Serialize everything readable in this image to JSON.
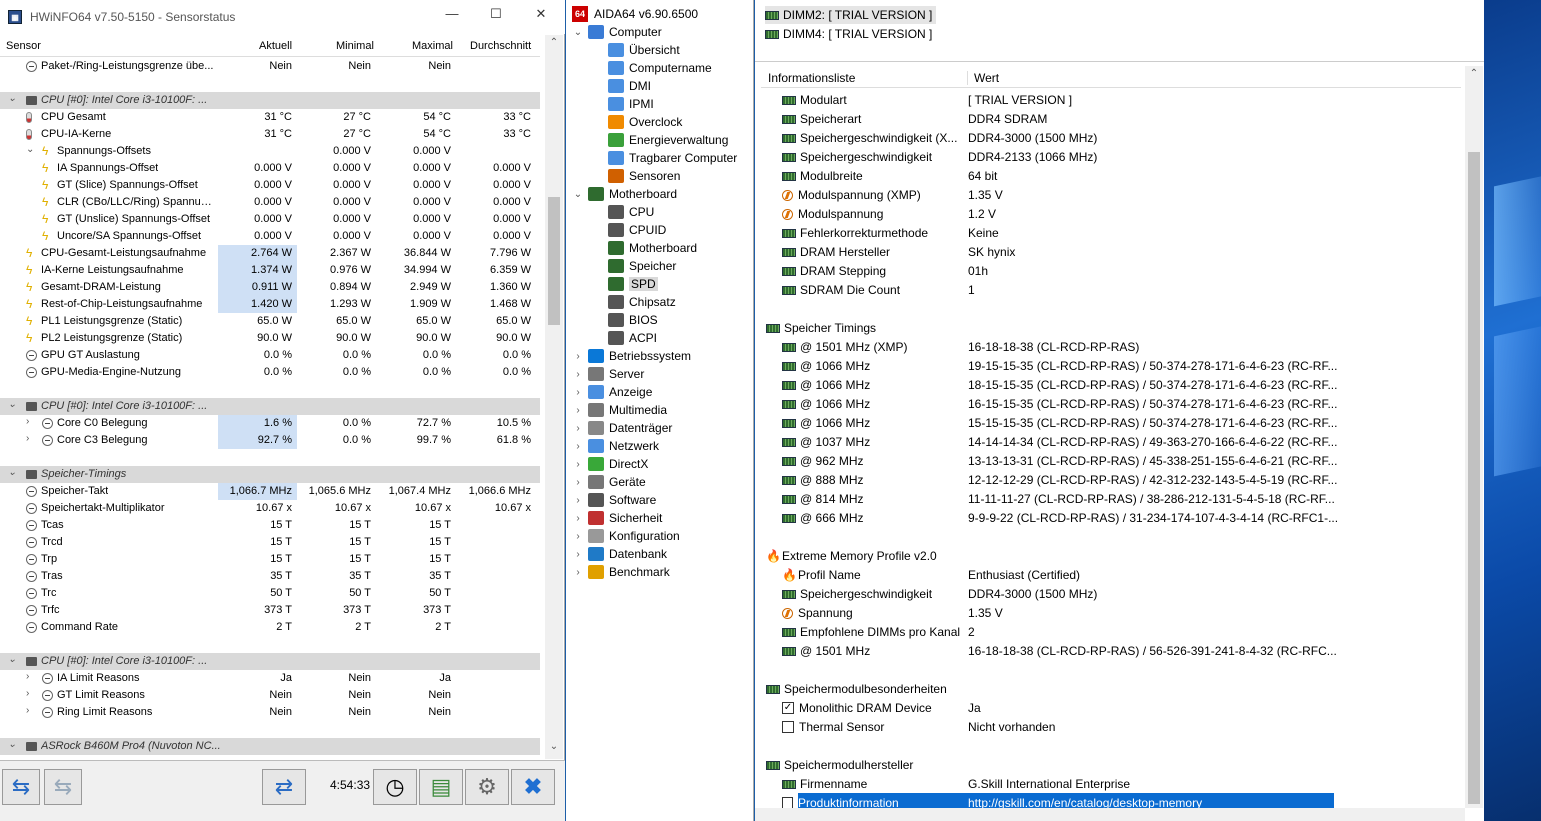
{
  "hwinfo": {
    "title": "HWiNFO64 v7.50-5150 - Sensorstatus",
    "columns": [
      "Sensor",
      "Aktuell",
      "Minimal",
      "Maximal",
      "Durchschnitt"
    ],
    "rows": [
      {
        "label": "Paket-/Ring-Leistungsgrenze übe...",
        "cur": "Nein",
        "min": "Nein",
        "max": "Nein",
        "avg": "",
        "ind": 1,
        "ic": "min"
      },
      {
        "label": "",
        "cur": "",
        "min": "",
        "max": "",
        "avg": "",
        "ind": 0,
        "ic": "none"
      },
      {
        "label": "CPU [#0]: Intel Core i3-10100F: ...",
        "cur": "",
        "min": "",
        "max": "",
        "avg": "",
        "ind": 0,
        "ic": "chip",
        "grp": true,
        "exp": "v"
      },
      {
        "label": "CPU Gesamt",
        "cur": "31 °C",
        "min": "27 °C",
        "max": "54 °C",
        "avg": "33 °C",
        "ind": 1,
        "ic": "therm"
      },
      {
        "label": "CPU-IA-Kerne",
        "cur": "31 °C",
        "min": "27 °C",
        "max": "54 °C",
        "avg": "33 °C",
        "ind": 1,
        "ic": "therm"
      },
      {
        "label": "Spannungs-Offsets",
        "cur": "",
        "min": "0.000 V",
        "max": "0.000 V",
        "avg": "",
        "ind": 2,
        "ic": "bolt",
        "exp": "v"
      },
      {
        "label": "IA Spannungs-Offset",
        "cur": "0.000 V",
        "min": "0.000 V",
        "max": "0.000 V",
        "avg": "0.000 V",
        "ind": 3,
        "ic": "bolt"
      },
      {
        "label": "GT (Slice) Spannungs-Offset",
        "cur": "0.000 V",
        "min": "0.000 V",
        "max": "0.000 V",
        "avg": "0.000 V",
        "ind": 3,
        "ic": "bolt"
      },
      {
        "label": "CLR (CBo/LLC/Ring) Spannun...",
        "cur": "0.000 V",
        "min": "0.000 V",
        "max": "0.000 V",
        "avg": "0.000 V",
        "ind": 3,
        "ic": "bolt"
      },
      {
        "label": "GT (Unslice) Spannungs-Offset",
        "cur": "0.000 V",
        "min": "0.000 V",
        "max": "0.000 V",
        "avg": "0.000 V",
        "ind": 3,
        "ic": "bolt"
      },
      {
        "label": "Uncore/SA Spannungs-Offset",
        "cur": "0.000 V",
        "min": "0.000 V",
        "max": "0.000 V",
        "avg": "0.000 V",
        "ind": 3,
        "ic": "bolt"
      },
      {
        "label": "CPU-Gesamt-Leistungsaufnahme",
        "cur": "2.764 W",
        "min": "2.367 W",
        "max": "36.844 W",
        "avg": "7.796 W",
        "ind": 1,
        "ic": "bolt",
        "hl": true
      },
      {
        "label": "IA-Kerne Leistungsaufnahme",
        "cur": "1.374 W",
        "min": "0.976 W",
        "max": "34.994 W",
        "avg": "6.359 W",
        "ind": 1,
        "ic": "bolt",
        "hl": true
      },
      {
        "label": "Gesamt-DRAM-Leistung",
        "cur": "0.911 W",
        "min": "0.894 W",
        "max": "2.949 W",
        "avg": "1.360 W",
        "ind": 1,
        "ic": "bolt",
        "hl": true
      },
      {
        "label": "Rest-of-Chip-Leistungsaufnahme",
        "cur": "1.420 W",
        "min": "1.293 W",
        "max": "1.909 W",
        "avg": "1.468 W",
        "ind": 1,
        "ic": "bolt",
        "hl": true
      },
      {
        "label": "PL1 Leistungsgrenze (Static)",
        "cur": "65.0 W",
        "min": "65.0 W",
        "max": "65.0 W",
        "avg": "65.0 W",
        "ind": 1,
        "ic": "bolt"
      },
      {
        "label": "PL2 Leistungsgrenze (Static)",
        "cur": "90.0 W",
        "min": "90.0 W",
        "max": "90.0 W",
        "avg": "90.0 W",
        "ind": 1,
        "ic": "bolt"
      },
      {
        "label": "GPU GT Auslastung",
        "cur": "0.0 %",
        "min": "0.0 %",
        "max": "0.0 %",
        "avg": "0.0 %",
        "ind": 1,
        "ic": "min"
      },
      {
        "label": "GPU-Media-Engine-Nutzung",
        "cur": "0.0 %",
        "min": "0.0 %",
        "max": "0.0 %",
        "avg": "0.0 %",
        "ind": 1,
        "ic": "min"
      },
      {
        "label": "",
        "cur": "",
        "min": "",
        "max": "",
        "avg": "",
        "ind": 0,
        "ic": "none"
      },
      {
        "label": "CPU [#0]: Intel Core i3-10100F: ...",
        "cur": "",
        "min": "",
        "max": "",
        "avg": "",
        "ind": 0,
        "ic": "chip",
        "grp": true,
        "exp": "v"
      },
      {
        "label": "Core C0 Belegung",
        "cur": "1.6 %",
        "min": "0.0 %",
        "max": "72.7 %",
        "avg": "10.5 %",
        "ind": 2,
        "ic": "min",
        "exp": ">",
        "hl": true
      },
      {
        "label": "Core C3 Belegung",
        "cur": "92.7 %",
        "min": "0.0 %",
        "max": "99.7 %",
        "avg": "61.8 %",
        "ind": 2,
        "ic": "min",
        "exp": ">",
        "hl": true
      },
      {
        "label": "",
        "cur": "",
        "min": "",
        "max": "",
        "avg": "",
        "ind": 0,
        "ic": "none"
      },
      {
        "label": "Speicher-Timings",
        "cur": "",
        "min": "",
        "max": "",
        "avg": "",
        "ind": 0,
        "ic": "chip",
        "grp": true,
        "exp": "v"
      },
      {
        "label": "Speicher-Takt",
        "cur": "1,066.7 MHz",
        "min": "1,065.6 MHz",
        "max": "1,067.4 MHz",
        "avg": "1,066.6 MHz",
        "ind": 1,
        "ic": "min",
        "hl": true
      },
      {
        "label": "Speichertakt-Multiplikator",
        "cur": "10.67 x",
        "min": "10.67 x",
        "max": "10.67 x",
        "avg": "10.67 x",
        "ind": 1,
        "ic": "min"
      },
      {
        "label": "Tcas",
        "cur": "15 T",
        "min": "15 T",
        "max": "15 T",
        "avg": "",
        "ind": 1,
        "ic": "min"
      },
      {
        "label": "Trcd",
        "cur": "15 T",
        "min": "15 T",
        "max": "15 T",
        "avg": "",
        "ind": 1,
        "ic": "min"
      },
      {
        "label": "Trp",
        "cur": "15 T",
        "min": "15 T",
        "max": "15 T",
        "avg": "",
        "ind": 1,
        "ic": "min"
      },
      {
        "label": "Tras",
        "cur": "35 T",
        "min": "35 T",
        "max": "35 T",
        "avg": "",
        "ind": 1,
        "ic": "min"
      },
      {
        "label": "Trc",
        "cur": "50 T",
        "min": "50 T",
        "max": "50 T",
        "avg": "",
        "ind": 1,
        "ic": "min"
      },
      {
        "label": "Trfc",
        "cur": "373 T",
        "min": "373 T",
        "max": "373 T",
        "avg": "",
        "ind": 1,
        "ic": "min"
      },
      {
        "label": "Command Rate",
        "cur": "2 T",
        "min": "2 T",
        "max": "2 T",
        "avg": "",
        "ind": 1,
        "ic": "min"
      },
      {
        "label": "",
        "cur": "",
        "min": "",
        "max": "",
        "avg": "",
        "ind": 0,
        "ic": "none"
      },
      {
        "label": "CPU [#0]: Intel Core i3-10100F: ...",
        "cur": "",
        "min": "",
        "max": "",
        "avg": "",
        "ind": 0,
        "ic": "chip",
        "grp": true,
        "exp": "v"
      },
      {
        "label": "IA Limit Reasons",
        "cur": "Ja",
        "min": "Nein",
        "max": "Ja",
        "avg": "",
        "ind": 2,
        "ic": "min",
        "exp": ">"
      },
      {
        "label": "GT Limit Reasons",
        "cur": "Nein",
        "min": "Nein",
        "max": "Nein",
        "avg": "",
        "ind": 2,
        "ic": "min",
        "exp": ">"
      },
      {
        "label": "Ring Limit Reasons",
        "cur": "Nein",
        "min": "Nein",
        "max": "Nein",
        "avg": "",
        "ind": 2,
        "ic": "min",
        "exp": ">"
      },
      {
        "label": "",
        "cur": "",
        "min": "",
        "max": "",
        "avg": "",
        "ind": 0,
        "ic": "none"
      },
      {
        "label": "ASRock B460M Pro4 (Nuvoton NC...",
        "cur": "",
        "min": "",
        "max": "",
        "avg": "",
        "ind": 0,
        "ic": "chip",
        "grp": true,
        "exp": "v"
      }
    ],
    "time": "4:54:33"
  },
  "aida": {
    "title": "AIDA64 v6.90.6500",
    "tree": [
      {
        "label": "Computer",
        "lvl": 0,
        "exp": "v",
        "color": "#3a7bd5"
      },
      {
        "label": "Übersicht",
        "lvl": 1,
        "color": "#4a8fe0"
      },
      {
        "label": "Computername",
        "lvl": 1,
        "color": "#4a8fe0"
      },
      {
        "label": "DMI",
        "lvl": 1,
        "color": "#4a8fe0"
      },
      {
        "label": "IPMI",
        "lvl": 1,
        "color": "#4a8fe0"
      },
      {
        "label": "Overclock",
        "lvl": 1,
        "color": "#f08a00"
      },
      {
        "label": "Energieverwaltung",
        "lvl": 1,
        "color": "#3aa03a"
      },
      {
        "label": "Tragbarer Computer",
        "lvl": 1,
        "color": "#4a8fe0"
      },
      {
        "label": "Sensoren",
        "lvl": 1,
        "color": "#d06000"
      },
      {
        "label": "Motherboard",
        "lvl": 0,
        "exp": "v",
        "color": "#2f6b2f"
      },
      {
        "label": "CPU",
        "lvl": 1,
        "color": "#555"
      },
      {
        "label": "CPUID",
        "lvl": 1,
        "color": "#555"
      },
      {
        "label": "Motherboard",
        "lvl": 1,
        "color": "#2f6b2f"
      },
      {
        "label": "Speicher",
        "lvl": 1,
        "color": "#2f6b2f"
      },
      {
        "label": "SPD",
        "lvl": 1,
        "color": "#2f6b2f",
        "sel": true
      },
      {
        "label": "Chipsatz",
        "lvl": 1,
        "color": "#555"
      },
      {
        "label": "BIOS",
        "lvl": 1,
        "color": "#555"
      },
      {
        "label": "ACPI",
        "lvl": 1,
        "color": "#555"
      },
      {
        "label": "Betriebssystem",
        "lvl": 0,
        "exp": ">",
        "color": "#0a78d7"
      },
      {
        "label": "Server",
        "lvl": 0,
        "exp": ">",
        "color": "#777"
      },
      {
        "label": "Anzeige",
        "lvl": 0,
        "exp": ">",
        "color": "#4a8fe0"
      },
      {
        "label": "Multimedia",
        "lvl": 0,
        "exp": ">",
        "color": "#777"
      },
      {
        "label": "Datenträger",
        "lvl": 0,
        "exp": ">",
        "color": "#888"
      },
      {
        "label": "Netzwerk",
        "lvl": 0,
        "exp": ">",
        "color": "#4a8fe0"
      },
      {
        "label": "DirectX",
        "lvl": 0,
        "exp": ">",
        "color": "#39a839"
      },
      {
        "label": "Geräte",
        "lvl": 0,
        "exp": ">",
        "color": "#777"
      },
      {
        "label": "Software",
        "lvl": 0,
        "exp": ">",
        "color": "#555"
      },
      {
        "label": "Sicherheit",
        "lvl": 0,
        "exp": ">",
        "color": "#c03030"
      },
      {
        "label": "Konfiguration",
        "lvl": 0,
        "exp": ">",
        "color": "#999"
      },
      {
        "label": "Datenbank",
        "lvl": 0,
        "exp": ">",
        "color": "#1f7ac7"
      },
      {
        "label": "Benchmark",
        "lvl": 0,
        "exp": ">",
        "color": "#e0a000"
      }
    ],
    "dimms": [
      "DIMM2: [ TRIAL VERSION ]",
      "DIMM4: [ TRIAL VERSION ]"
    ],
    "list_header": {
      "field": "Informationsliste",
      "value": "Wert"
    },
    "list": [
      {
        "f": "Modulart",
        "v": "[ TRIAL VERSION ]",
        "ic": "ram",
        "lvl": 1
      },
      {
        "f": "Speicherart",
        "v": "DDR4 SDRAM",
        "ic": "ram",
        "lvl": 1
      },
      {
        "f": "Speichergeschwindigkeit (X...",
        "v": "DDR4-3000 (1500 MHz)",
        "ic": "ram",
        "lvl": 1
      },
      {
        "f": "Speichergeschwindigkeit",
        "v": "DDR4-2133 (1066 MHz)",
        "ic": "ram",
        "lvl": 1
      },
      {
        "f": "Modulbreite",
        "v": "64 bit",
        "ic": "ram",
        "lvl": 1
      },
      {
        "f": "Modulspannung (XMP)",
        "v": "1.35 V",
        "ic": "span",
        "lvl": 1
      },
      {
        "f": "Modulspannung",
        "v": "1.2 V",
        "ic": "span",
        "lvl": 1
      },
      {
        "f": "Fehlerkorrekturmethode",
        "v": "Keine",
        "ic": "ram",
        "lvl": 1
      },
      {
        "f": "DRAM Hersteller",
        "v": "SK hynix",
        "ic": "ram",
        "lvl": 1
      },
      {
        "f": "DRAM Stepping",
        "v": "01h",
        "ic": "ram",
        "lvl": 1
      },
      {
        "f": "SDRAM Die Count",
        "v": "1",
        "ic": "ram",
        "lvl": 1
      },
      {
        "f": "",
        "v": "",
        "ic": "none",
        "lvl": 0
      },
      {
        "f": "Speicher Timings",
        "v": "",
        "ic": "ram",
        "lvl": 0
      },
      {
        "f": "@ 1501 MHz (XMP)",
        "v": "16-18-18-38  (CL-RCD-RP-RAS)",
        "ic": "ram",
        "lvl": 1
      },
      {
        "f": "@ 1066 MHz",
        "v": "19-15-15-35  (CL-RCD-RP-RAS) / 50-374-278-171-6-4-6-23  (RC-RF...",
        "ic": "ram",
        "lvl": 1
      },
      {
        "f": "@ 1066 MHz",
        "v": "18-15-15-35  (CL-RCD-RP-RAS) / 50-374-278-171-6-4-6-23  (RC-RF...",
        "ic": "ram",
        "lvl": 1
      },
      {
        "f": "@ 1066 MHz",
        "v": "16-15-15-35  (CL-RCD-RP-RAS) / 50-374-278-171-6-4-6-23  (RC-RF...",
        "ic": "ram",
        "lvl": 1
      },
      {
        "f": "@ 1066 MHz",
        "v": "15-15-15-35  (CL-RCD-RP-RAS) / 50-374-278-171-6-4-6-23  (RC-RF...",
        "ic": "ram",
        "lvl": 1
      },
      {
        "f": "@ 1037 MHz",
        "v": "14-14-14-34  (CL-RCD-RP-RAS) / 49-363-270-166-6-4-6-22  (RC-RF...",
        "ic": "ram",
        "lvl": 1
      },
      {
        "f": "@ 962 MHz",
        "v": "13-13-13-31  (CL-RCD-RP-RAS) / 45-338-251-155-6-4-6-21  (RC-RF...",
        "ic": "ram",
        "lvl": 1
      },
      {
        "f": "@ 888 MHz",
        "v": "12-12-12-29  (CL-RCD-RP-RAS) / 42-312-232-143-5-4-5-19  (RC-RF...",
        "ic": "ram",
        "lvl": 1
      },
      {
        "f": "@ 814 MHz",
        "v": "11-11-11-27  (CL-RCD-RP-RAS) / 38-286-212-131-5-4-5-18  (RC-RF...",
        "ic": "ram",
        "lvl": 1
      },
      {
        "f": "@ 666 MHz",
        "v": "9-9-9-22  (CL-RCD-RP-RAS) / 31-234-174-107-4-3-4-14  (RC-RFC1-...",
        "ic": "ram",
        "lvl": 1
      },
      {
        "f": "",
        "v": "",
        "ic": "none",
        "lvl": 0
      },
      {
        "f": "Extreme Memory Profile v2.0",
        "v": "",
        "ic": "flame",
        "lvl": 0
      },
      {
        "f": "Profil Name",
        "v": "Enthusiast (Certified)",
        "ic": "flame",
        "lvl": 1
      },
      {
        "f": "Speichergeschwindigkeit",
        "v": "DDR4-3000 (1500 MHz)",
        "ic": "ram",
        "lvl": 1
      },
      {
        "f": "Spannung",
        "v": "1.35 V",
        "ic": "span",
        "lvl": 1
      },
      {
        "f": "Empfohlene DIMMs pro Kanal",
        "v": "2",
        "ic": "ram",
        "lvl": 1
      },
      {
        "f": "@ 1501 MHz",
        "v": "16-18-18-38  (CL-RCD-RP-RAS) / 56-526-391-241-8-4-32  (RC-RFC...",
        "ic": "ram",
        "lvl": 1
      },
      {
        "f": "",
        "v": "",
        "ic": "none",
        "lvl": 0
      },
      {
        "f": "Speichermodulbesonderheiten",
        "v": "",
        "ic": "ram",
        "lvl": 0
      },
      {
        "f": "Monolithic DRAM Device",
        "v": "Ja",
        "ic": "chk1",
        "lvl": 1
      },
      {
        "f": "Thermal Sensor",
        "v": "Nicht vorhanden",
        "ic": "chk0",
        "lvl": 1
      },
      {
        "f": "",
        "v": "",
        "ic": "none",
        "lvl": 0
      },
      {
        "f": "Speichermodulhersteller",
        "v": "",
        "ic": "ram",
        "lvl": 0
      },
      {
        "f": "Firmenname",
        "v": "G.Skill International Enterprise",
        "ic": "ram",
        "lvl": 1
      },
      {
        "f": "Produktinformation",
        "v": "http://gskill.com/en/catalog/desktop-memory",
        "ic": "doc",
        "lvl": 1,
        "sel": true
      }
    ]
  }
}
